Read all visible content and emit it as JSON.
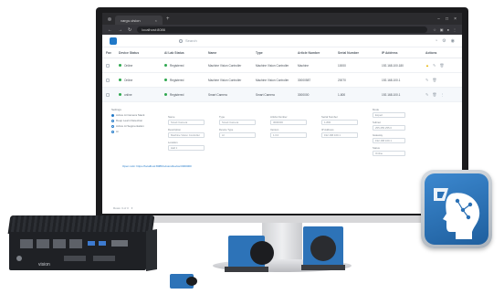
{
  "browser": {
    "tab_title": "vargo-vision",
    "url": "localhost:8086",
    "new_tab_symbol": "+",
    "window_controls": [
      "−",
      "□",
      "×"
    ]
  },
  "app": {
    "search_placeholder": "Search",
    "header_icons": [
      "bell-icon",
      "settings-icon",
      "user-icon"
    ]
  },
  "table": {
    "headers": [
      "Fav",
      "Device Status",
      "AI Lab Status",
      "Name",
      "",
      "Type",
      "Article Number",
      "Serial Number",
      "IP Address",
      "Actions"
    ],
    "rows": [
      {
        "device_status": "Online",
        "ai_lab_status": "Registered",
        "name": "Machine Vision Controller",
        "type": "Machine Vision Controller",
        "article": "Machine",
        "serial": "10000",
        "ip": "192.168.100.180",
        "warning": true
      },
      {
        "device_status": "Online",
        "ai_lab_status": "Registered",
        "name": "Machine Vision Controller",
        "type": "Machine Vision Controller",
        "article": "30000587",
        "serial": "20070",
        "ip": "192.168.100.1",
        "warning": false
      },
      {
        "device_status": "online",
        "ai_lab_status": "Registered",
        "name": "Smart Camera",
        "type": "Smart Camera",
        "article": "3000000",
        "serial": "1-800",
        "ip": "192.168.100.1",
        "warning": false
      }
    ]
  },
  "detail": {
    "options_label": "Settings",
    "options": [
      "Active Ai Camera Stack",
      "Deep Learn Detection",
      "Active Ai Segmentation",
      "Ai"
    ],
    "fields": [
      {
        "label": "Name",
        "value": "Smart Camera"
      },
      {
        "label": "Type",
        "value": "Smart Camera"
      },
      {
        "label": "Article Number",
        "value": "3000000"
      },
      {
        "label": "Serial Number",
        "value": "1-800"
      },
      {
        "label": "Description",
        "value": "Machine Vision Controller"
      },
      {
        "label": "Device Type",
        "value": "AI"
      },
      {
        "label": "Version",
        "value": "1.0.0"
      },
      {
        "label": "IP Address",
        "value": "192.168.100.1"
      },
      {
        "label": "Location",
        "value": "Hall 1"
      },
      {
        "label": "Mode",
        "value": "Expert"
      },
      {
        "label": "Subnet",
        "value": "255.255.255.0"
      },
      {
        "label": "Gateway",
        "value": "192.168.100.1"
      },
      {
        "label": "Status",
        "value": "Online"
      }
    ],
    "link_text": "Open Link: https://localhost:8086/vvision/device/3000000",
    "footer_text": "Rows: 3 of 3"
  },
  "hardware": {
    "pc_label": "vision"
  },
  "colors": {
    "accent": "#1f78c8",
    "online": "#2fa84f",
    "warning": "#e8b400",
    "camera_blue": "#2d73b8",
    "badge_blue": "#2a70b5"
  }
}
